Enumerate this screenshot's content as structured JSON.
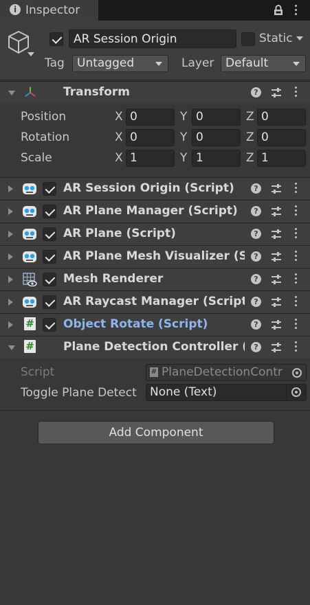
{
  "tab": {
    "title": "Inspector",
    "info_icon": "info-icon"
  },
  "object": {
    "name": "AR Session Origin",
    "active": true,
    "static_label": "Static",
    "static": false,
    "tag_label": "Tag",
    "tag_value": "Untagged",
    "layer_label": "Layer",
    "layer_value": "Default"
  },
  "transform": {
    "title": "Transform",
    "rows": [
      {
        "label": "Position",
        "x": "0",
        "y": "0",
        "z": "0"
      },
      {
        "label": "Rotation",
        "x": "0",
        "y": "0",
        "z": "0"
      },
      {
        "label": "Scale",
        "x": "1",
        "y": "1",
        "z": "1"
      }
    ],
    "axes": {
      "x": "X",
      "y": "Y",
      "z": "Z"
    }
  },
  "components": [
    {
      "title": "AR Session Origin (Script)",
      "icon": "robot-icon",
      "enabled": true
    },
    {
      "title": "AR Plane Manager (Script)",
      "icon": "robot-icon",
      "enabled": true
    },
    {
      "title": "AR Plane (Script)",
      "icon": "robot-icon",
      "enabled": true
    },
    {
      "title": "AR Plane Mesh Visualizer (Sc",
      "icon": "robot-icon",
      "enabled": true
    },
    {
      "title": "Mesh Renderer",
      "icon": "mesh-renderer-icon",
      "enabled": true
    },
    {
      "title": "AR Raycast Manager (Script",
      "icon": "robot-icon",
      "enabled": true
    },
    {
      "title": "Object Rotate (Script)",
      "icon": "script-hash-icon",
      "enabled": true,
      "highlight": "#8fb4ee"
    },
    {
      "title": "Plane Detection Controller (S",
      "icon": "script-hash-icon"
    }
  ],
  "plane_detection": {
    "script_label": "Script",
    "script_value": "PlaneDetectionContr",
    "toggle_label": "Toggle Plane Detect",
    "toggle_value": "None (Text)"
  },
  "add_component_label": "Add Component"
}
